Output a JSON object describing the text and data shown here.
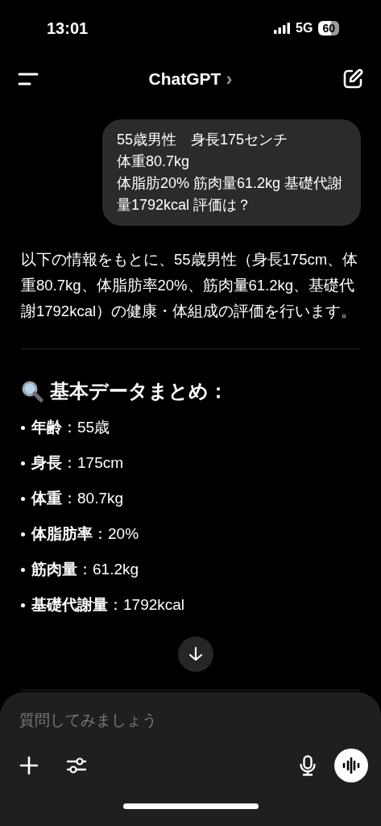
{
  "status_bar": {
    "time": "13:01",
    "network": "5G",
    "battery": "60"
  },
  "header": {
    "title": "ChatGPT",
    "chevron": "›"
  },
  "user_message": [
    "55歳男性　身長175センチ",
    "体重80.7kg",
    "体脂肪20% 筋肉量61.2kg 基礎代謝量1792kcal 評価は？"
  ],
  "assistant": {
    "intro": "以下の情報をもとに、55歳男性（身長175cm、体重80.7kg、体脂肪率20%、筋肉量61.2kg、基礎代謝1792kcal）の健康・体組成の評価を行います。",
    "heading": "基本データまとめ：",
    "items": [
      {
        "text": "**年齢**：55歳"
      },
      {
        "text": "**身長**：175cm"
      },
      {
        "text": "**体重**：80.7kg"
      },
      {
        "text": "**体脂肪率**：20%"
      },
      {
        "text": "**筋肉量**：61.2kg"
      },
      {
        "text": "**基礎代謝量**：1792kcal"
      }
    ]
  },
  "composer": {
    "placeholder": "質問してみましょう"
  }
}
